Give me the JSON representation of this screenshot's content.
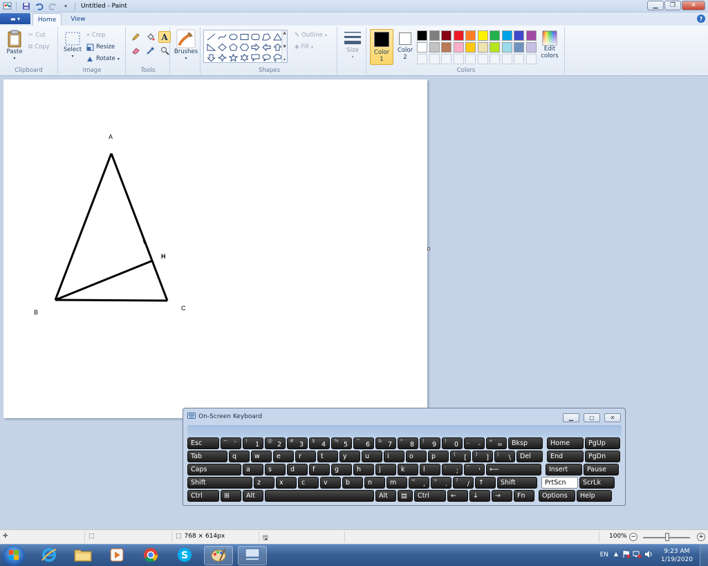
{
  "window": {
    "title": "Untitled - Paint"
  },
  "tabs": {
    "home": "Home",
    "view": "View"
  },
  "ribbon": {
    "clipboard": {
      "label": "Clipboard",
      "paste": "Paste",
      "cut": "Cut",
      "copy": "Copy"
    },
    "image": {
      "label": "Image",
      "select": "Select",
      "crop": "Crop",
      "resize": "Resize",
      "rotate": "Rotate"
    },
    "tools": {
      "label": "Tools"
    },
    "brushes": {
      "label": "Brushes"
    },
    "shapes": {
      "label": "Shapes",
      "outline": "Outline",
      "fill": "Fill"
    },
    "size": {
      "label": "Size"
    },
    "colors": {
      "label": "Colors",
      "color1_line1": "Color",
      "color1_line2": "1",
      "color2_line1": "Color",
      "color2_line2": "2",
      "color1": "#000000",
      "color2": "#ffffff",
      "edit_line1": "Edit",
      "edit_line2": "colors",
      "palette": [
        "#000000",
        "#7f7f7f",
        "#880015",
        "#ed1c24",
        "#ff7f27",
        "#fff200",
        "#22b14c",
        "#00a2e8",
        "#3f48cc",
        "#a349a4",
        "#ffffff",
        "#c3c3c3",
        "#b97a57",
        "#ffaec9",
        "#ffc90e",
        "#efe4b0",
        "#b5e61d",
        "#99d9ea",
        "#7092be",
        "#c8bfe7"
      ]
    }
  },
  "canvas": {
    "labels": {
      "a": "A",
      "b": "B",
      "c": "C",
      "h": "H"
    }
  },
  "osk": {
    "title": "On-Screen Keyboard",
    "rows": [
      [
        [
          "Esc",
          ""
        ],
        [
          "`",
          "~"
        ],
        [
          "1",
          "!"
        ],
        [
          "2",
          "@"
        ],
        [
          "3",
          "#"
        ],
        [
          "4",
          "$"
        ],
        [
          "5",
          "%"
        ],
        [
          "6",
          "^"
        ],
        [
          "7",
          "&"
        ],
        [
          "8",
          "*"
        ],
        [
          "9",
          "("
        ],
        [
          "0",
          ")"
        ],
        [
          "-",
          "_"
        ],
        [
          "=",
          "+"
        ],
        [
          "Bksp",
          ""
        ],
        [
          "Home",
          ""
        ],
        [
          "PgUp",
          ""
        ]
      ],
      [
        [
          "Tab",
          ""
        ],
        [
          "q",
          ""
        ],
        [
          "w",
          ""
        ],
        [
          "e",
          ""
        ],
        [
          "r",
          ""
        ],
        [
          "t",
          ""
        ],
        [
          "y",
          ""
        ],
        [
          "u",
          ""
        ],
        [
          "i",
          ""
        ],
        [
          "o",
          ""
        ],
        [
          "p",
          ""
        ],
        [
          "[",
          "{"
        ],
        [
          "]",
          "}"
        ],
        [
          "\\",
          "|"
        ],
        [
          "Del",
          ""
        ],
        [
          "End",
          ""
        ],
        [
          "PgDn",
          ""
        ]
      ],
      [
        [
          "Caps",
          ""
        ],
        [
          "a",
          ""
        ],
        [
          "s",
          ""
        ],
        [
          "d",
          ""
        ],
        [
          "f",
          ""
        ],
        [
          "g",
          ""
        ],
        [
          "h",
          ""
        ],
        [
          "j",
          ""
        ],
        [
          "k",
          ""
        ],
        [
          "l",
          ""
        ],
        [
          ";",
          ":"
        ],
        [
          "'",
          "\""
        ],
        [
          "⟵",
          ""
        ],
        [
          "Insert",
          ""
        ],
        [
          "Pause",
          ""
        ]
      ],
      [
        [
          "Shift",
          ""
        ],
        [
          "z",
          ""
        ],
        [
          "x",
          ""
        ],
        [
          "c",
          ""
        ],
        [
          "v",
          ""
        ],
        [
          "b",
          ""
        ],
        [
          "n",
          ""
        ],
        [
          "m",
          ""
        ],
        [
          ",",
          "<"
        ],
        [
          ".",
          ">"
        ],
        [
          "/",
          "?"
        ],
        [
          "↑",
          ""
        ],
        [
          "Shift",
          ""
        ],
        [
          "PrtScn",
          ""
        ],
        [
          "ScrLk",
          ""
        ]
      ],
      [
        [
          "Ctrl",
          ""
        ],
        [
          "⊞",
          ""
        ],
        [
          "Alt",
          ""
        ],
        [
          "",
          ""
        ],
        [
          "Alt",
          ""
        ],
        [
          "▤",
          ""
        ],
        [
          "Ctrl",
          ""
        ],
        [
          "←",
          ""
        ],
        [
          "↓",
          ""
        ],
        [
          "→",
          ""
        ],
        [
          "Fn",
          ""
        ],
        [
          "Options",
          ""
        ],
        [
          "Help",
          ""
        ]
      ]
    ]
  },
  "status": {
    "dimensions": "768 × 614px",
    "zoom": "100%"
  },
  "taskbar": {
    "lang": "EN",
    "time": "9:23 AM",
    "date": "1/19/2020"
  }
}
